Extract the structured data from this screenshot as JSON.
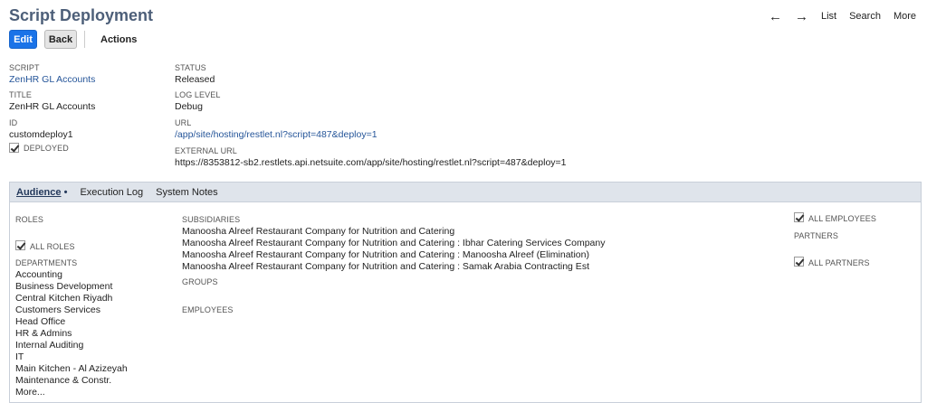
{
  "header": {
    "title": "Script Deployment",
    "nav": {
      "back_arrow": "←",
      "forward_arrow": "→",
      "list": "List",
      "search": "Search",
      "more": "More"
    }
  },
  "toolbar": {
    "edit": "Edit",
    "back": "Back",
    "actions": "Actions"
  },
  "fields": {
    "script": {
      "label": "SCRIPT",
      "value": "ZenHR GL Accounts"
    },
    "title": {
      "label": "TITLE",
      "value": "ZenHR GL Accounts"
    },
    "id": {
      "label": "ID",
      "value": "customdeploy1"
    },
    "deployed": {
      "label": "DEPLOYED",
      "checked": true
    },
    "status": {
      "label": "STATUS",
      "value": "Released"
    },
    "log_level": {
      "label": "LOG LEVEL",
      "value": "Debug"
    },
    "url": {
      "label": "URL",
      "value": "/app/site/hosting/restlet.nl?script=487&deploy=1"
    },
    "external_url": {
      "label": "EXTERNAL URL",
      "value": "https://8353812-sb2.restlets.api.netsuite.com/app/site/hosting/restlet.nl?script=487&deploy=1"
    }
  },
  "tabs": [
    {
      "label": "Audience",
      "suffix": " •",
      "active": true
    },
    {
      "label": "Execution Log",
      "active": false
    },
    {
      "label": "System Notes",
      "active": false
    }
  ],
  "audience": {
    "roles_label": "ROLES",
    "all_roles_label": "ALL ROLES",
    "departments_label": "DEPARTMENTS",
    "departments": [
      "Accounting",
      "Business Development",
      "Central Kitchen Riyadh",
      "Customers Services",
      "Head Office",
      "HR & Admins",
      "Internal Auditing",
      "IT",
      "Main Kitchen - Al Azizeyah",
      "Maintenance & Constr."
    ],
    "more_link": "More...",
    "subsidiaries_label": "SUBSIDIARIES",
    "subsidiaries": [
      "Manoosha Alreef Restaurant Company for Nutrition and Catering",
      "Manoosha Alreef Restaurant Company for Nutrition and Catering : Ibhar Catering Services Company",
      "Manoosha Alreef Restaurant Company for Nutrition and Catering : Manoosha Alreef (Elimination)",
      "Manoosha Alreef Restaurant Company for Nutrition and Catering : Samak Arabia Contracting Est"
    ],
    "groups_label": "GROUPS",
    "employees_label": "EMPLOYEES",
    "all_employees_label": "ALL EMPLOYEES",
    "partners_label": "PARTNERS",
    "all_partners_label": "ALL PARTNERS"
  }
}
